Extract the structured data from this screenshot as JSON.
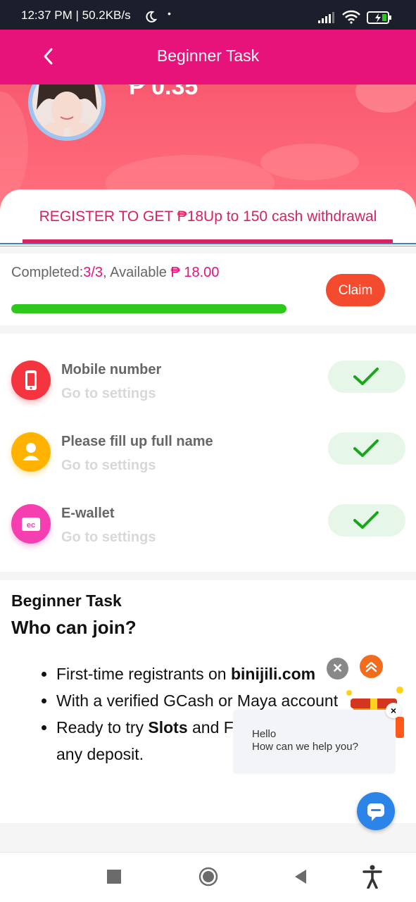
{
  "status_bar": {
    "time": "12:37 PM | 50.2KB/s",
    "dot": "•",
    "icons": [
      "moon-icon",
      "signal-icon",
      "wifi-icon",
      "battery-charging-icon"
    ]
  },
  "header": {
    "title": "Beginner Task",
    "back_icon": "chevron-left-icon"
  },
  "hero": {
    "balance": "₱ 0.35",
    "colors": {
      "gradient_top": "#f85a6f",
      "gradient_bottom": "#ff7c86"
    }
  },
  "tab": {
    "label": "REGISTER TO GET ₱18Up to 150 cash withdrawal"
  },
  "progress": {
    "completed_label": "Completed:",
    "completed_value": "3/3",
    "available_label": ", Available ",
    "available_value": "₱ 18.00",
    "claim_label": "Claim",
    "fraction": 1.0
  },
  "tasks": [
    {
      "name": "Mobile number",
      "sub": "Go to settings",
      "icon": "phone-icon",
      "color": "#f4343f",
      "done": true
    },
    {
      "name": "Please fill up full name",
      "sub": "Go to settings",
      "icon": "user-icon",
      "color": "#ffb300",
      "done": true
    },
    {
      "name": "E-wallet",
      "sub": "Go to settings",
      "icon": "wallet-icon",
      "color": "#f53fb0",
      "done": true
    }
  ],
  "rules": {
    "section_title": "Beginner Task",
    "heading": "Who can join?",
    "items": [
      {
        "text_before": "First-time registrants on ",
        "bold": "binijili.com",
        "text_after": ""
      },
      {
        "text_before": "With a verified GCash or Maya account",
        "bold": "",
        "text_after": ""
      },
      {
        "text_before": "Ready to try ",
        "bold": "Slots",
        "text_after": " and Fishing games without"
      },
      {
        "text_before": "any deposit.",
        "bold": "",
        "text_after": ""
      }
    ]
  },
  "chat": {
    "greeting": "Hello",
    "question": "How can we help you?",
    "close_glyph": "×",
    "dismiss_glyph": "✕"
  },
  "colors": {
    "brand": "#e8127b",
    "accent_text": "#d6235f",
    "progress": "#2ec81d",
    "claim": "#f44a2d",
    "chat": "#2c84e8"
  }
}
